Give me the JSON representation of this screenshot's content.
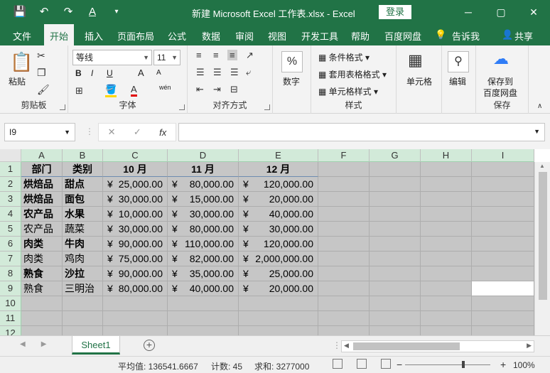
{
  "titlebar": {
    "title": "新建 Microsoft Excel 工作表.xlsx - Excel",
    "login": "登录",
    "qat": [
      "💾",
      "↶",
      "↷",
      "A",
      "▾"
    ],
    "win": [
      "─",
      "▢",
      "✕"
    ]
  },
  "tabs": [
    "文件",
    "开始",
    "插入",
    "页面布局",
    "公式",
    "数据",
    "审阅",
    "视图",
    "开发工具",
    "帮助",
    "百度网盘",
    "告诉我",
    "共享"
  ],
  "active_tab": "开始",
  "ribbon": {
    "clipboard": {
      "paste": "粘贴",
      "label": "剪贴板"
    },
    "font": {
      "name": "等线",
      "size": "11",
      "label": "字体",
      "bold": "B",
      "italic": "I",
      "underline": "U",
      "grow": "A",
      "shrink": "A",
      "wen": "wén"
    },
    "align": {
      "label": "对齐方式"
    },
    "number": {
      "button": "数字",
      "pct": "%"
    },
    "styles": {
      "cond": "条件格式",
      "table": "套用表格格式",
      "cell": "单元格样式",
      "label": "样式"
    },
    "cells": {
      "button": "单元格"
    },
    "edit": {
      "button": "编辑"
    },
    "save": {
      "line1": "保存到",
      "line2": "百度网盘",
      "label": "保存"
    }
  },
  "formula_bar": {
    "name_box": "I9",
    "cancel": "✕",
    "enter": "✓",
    "fx": "fx",
    "value": ""
  },
  "columns": [
    "A",
    "B",
    "C",
    "D",
    "E",
    "F",
    "G",
    "H",
    "I"
  ],
  "rows": [
    "1",
    "2",
    "3",
    "4",
    "5",
    "6",
    "7",
    "8",
    "9",
    "10",
    "11",
    "12"
  ],
  "table": {
    "header": [
      "部门",
      "类别",
      "10 月",
      "11 月",
      "12 月"
    ],
    "currency": "¥",
    "body": [
      [
        "烘焙品",
        "甜点",
        "25,000.00",
        "80,000.00",
        "120,000.00"
      ],
      [
        "烘焙品",
        "面包",
        "30,000.00",
        "15,000.00",
        "20,000.00"
      ],
      [
        "农产品",
        "水果",
        "10,000.00",
        "30,000.00",
        "40,000.00"
      ],
      [
        "农产品",
        "蔬菜",
        "30,000.00",
        "80,000.00",
        "30,000.00"
      ],
      [
        "肉类",
        "牛肉",
        "90,000.00",
        "110,000.00",
        "120,000.00"
      ],
      [
        "肉类",
        "鸡肉",
        "75,000.00",
        "82,000.00",
        "2,000,000.00"
      ],
      [
        "熟食",
        "沙拉",
        "90,000.00",
        "35,000.00",
        "25,000.00"
      ],
      [
        "熟食",
        "三明治",
        "80,000.00",
        "40,000.00",
        "20,000.00"
      ]
    ]
  },
  "sheet": {
    "tab": "Sheet1",
    "add": "+"
  },
  "status": {
    "avg": "平均值: 136541.6667",
    "count": "计数: 45",
    "sum": "求和: 3277000",
    "zoom_minus": "−",
    "zoom_plus": "+",
    "zoom": "100%"
  }
}
